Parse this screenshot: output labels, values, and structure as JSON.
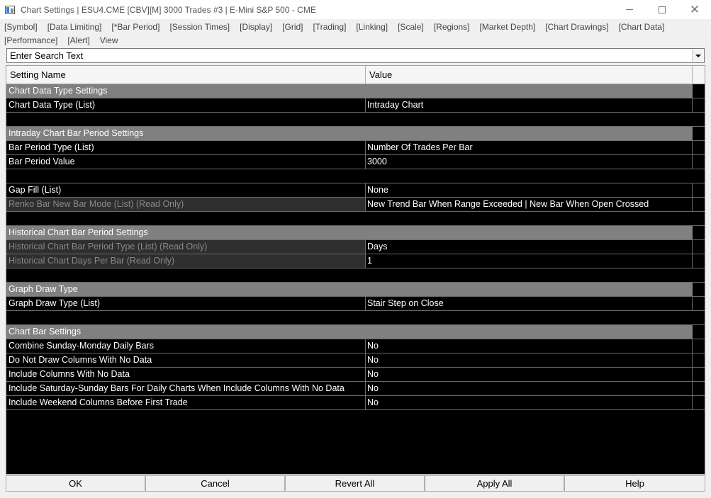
{
  "window": {
    "title": "Chart Settings | ESU4.CME [CBV][M]  3000 Trades #3 | E-Mini S&P 500 - CME"
  },
  "menu": {
    "row1": [
      "[Symbol]",
      "[Data Limiting]",
      "[*Bar Period]",
      "[Session Times]",
      "[Display]",
      "[Grid]",
      "[Trading]",
      "[Linking]",
      "[Scale]",
      "[Regions]",
      "[Market Depth]",
      "[Chart Drawings]",
      "[Chart Data]"
    ],
    "row2": [
      "[Performance]",
      "[Alert]",
      "View"
    ]
  },
  "search": {
    "text": "Enter Search Text"
  },
  "grid": {
    "headers": {
      "name": "Setting Name",
      "value": "Value"
    },
    "rows": [
      {
        "type": "section",
        "name": "Chart Data Type Settings"
      },
      {
        "type": "setting",
        "name": "Chart Data Type (List)",
        "value": "Intraday Chart"
      },
      {
        "type": "blank"
      },
      {
        "type": "section",
        "name": "Intraday Chart Bar Period Settings"
      },
      {
        "type": "setting",
        "name": "Bar Period Type (List)",
        "value": "Number Of Trades Per Bar"
      },
      {
        "type": "setting",
        "name": "Bar Period Value",
        "value": "3000"
      },
      {
        "type": "blank"
      },
      {
        "type": "setting",
        "name": "Gap Fill (List)",
        "value": "None"
      },
      {
        "type": "readonly",
        "name": "Renko Bar New Bar Mode (List) (Read Only)",
        "value": "New Trend Bar When Range Exceeded | New Bar When Open Crossed"
      },
      {
        "type": "blank"
      },
      {
        "type": "section",
        "name": "Historical Chart Bar Period Settings"
      },
      {
        "type": "readonly",
        "name": "Historical Chart Bar Period Type (List) (Read Only)",
        "value": "Days"
      },
      {
        "type": "readonly",
        "name": "Historical Chart Days Per Bar (Read Only)",
        "value": "1"
      },
      {
        "type": "blank"
      },
      {
        "type": "section",
        "name": "Graph Draw Type"
      },
      {
        "type": "setting",
        "name": "Graph Draw Type (List)",
        "value": "Stair Step on Close"
      },
      {
        "type": "blank"
      },
      {
        "type": "section",
        "name": "Chart Bar Settings"
      },
      {
        "type": "setting",
        "name": "Combine Sunday-Monday Daily Bars",
        "value": "No"
      },
      {
        "type": "setting",
        "name": "Do Not Draw Columns With No Data",
        "value": "No"
      },
      {
        "type": "setting",
        "name": "Include Columns With No Data",
        "value": "No"
      },
      {
        "type": "setting",
        "name": "Include Saturday-Sunday Bars For Daily Charts When Include Columns With No Data",
        "value": "No"
      },
      {
        "type": "setting",
        "name": "Include Weekend Columns Before First Trade",
        "value": "No"
      }
    ]
  },
  "buttons": {
    "ok": "OK",
    "cancel": "Cancel",
    "revert_all": "Revert All",
    "apply_all": "Apply All",
    "help": "Help"
  },
  "colors": {
    "grid_background": "#000000",
    "section_background": "#808080",
    "readonly_background": "#2e2e2e",
    "readonly_text": "#8a8a8a"
  }
}
